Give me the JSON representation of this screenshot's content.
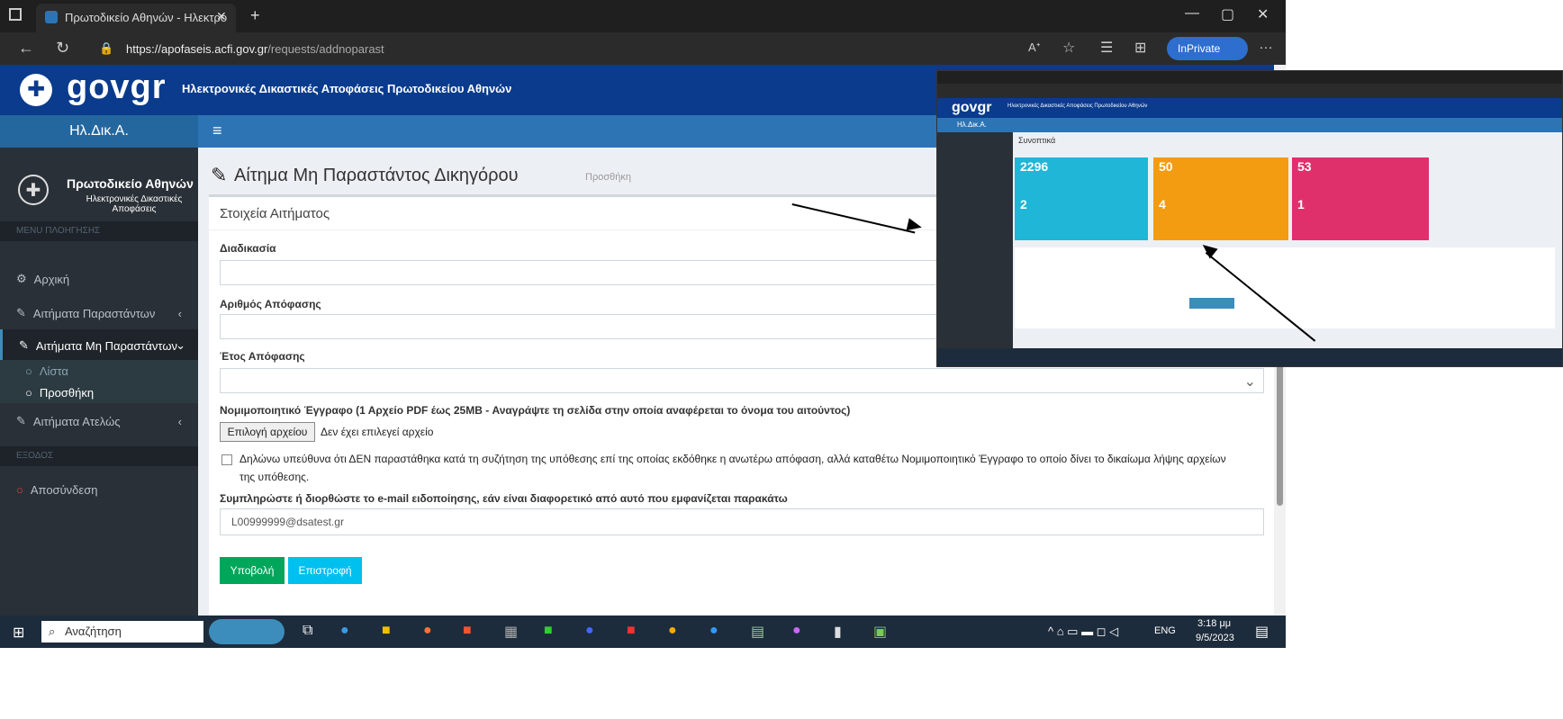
{
  "browser": {
    "tab_title": "Πρωτοδικείο Αθηνών - Ηλεκτρο",
    "url_domain": "https://apofaseis.acfi.gov.gr",
    "url_path": "/requests/addnoparast",
    "inprivate": "InPrivate"
  },
  "site": {
    "logo": "govgr",
    "header_title": "Ηλεκτρονικές Δικαστικές Αποφάσεις Πρωτοδικείου Αθηνών",
    "brand": "Ηλ.Δικ.Α.",
    "menu_icon": "hamburger-icon"
  },
  "sidebar": {
    "org_title": "Πρωτοδικείο Αθηνών",
    "org_subtitle_1": "Ηλεκτρονικές Δικαστικές",
    "org_subtitle_2": "Αποφάσεις",
    "section_main": "MENU ΠΛΟΗΓΗΣΗΣ",
    "items": [
      {
        "label": "Αρχική",
        "icon": "dashboard-icon"
      },
      {
        "label": "Αιτήματα Παραστάντων",
        "icon": "edit-icon"
      },
      {
        "label": "Αιτήματα Μη Παραστάντων",
        "icon": "edit-icon"
      },
      {
        "label": "Λίστα",
        "icon": "circle-icon"
      },
      {
        "label": "Προσθήκη",
        "icon": "circle-icon"
      },
      {
        "label": "Αιτήματα Ατελώς",
        "icon": "edit-icon"
      }
    ],
    "section_exit": "ΕΞΟΔΟΣ",
    "logout": "Αποσύνδεση"
  },
  "page": {
    "title": "Αίτημα Μη Παραστάντος Δικηγόρου",
    "subtitle": "Προσθήκη",
    "box_title": "Στοιχεία Αιτήματος",
    "label_procedure": "Διαδικασία",
    "label_decision_number": "Αριθμός Απόφασης",
    "label_decision_year": "Έτος Απόφασης",
    "label_document": "Νομιμοποιητικό Έγγραφο (1 Αρχείο PDF έως 25MB - Αναγράψτε τη σελίδα στην οποία αναφέρεται το όνομα του αιτούντος)",
    "file_button": "Επιλογή αρχείου",
    "file_status": "Δεν έχει επιλεγεί αρχείο",
    "declaration_1": "Δηλώνω υπεύθυνα ότι ΔΕΝ παραστάθηκα κατά τη συζήτηση της υπόθεσης επί της οποίας εκδόθηκε η ανωτέρω απόφαση, αλλά καταθέτω Νομιμοποιητικό Έγγραφο το οποίο δίνει το δικαίωμα λήψης αρχείων",
    "declaration_2": "της υπόθεσης.",
    "label_email": "Συμπληρώστε ή διορθώστε το e-mail ειδοποίησης, εάν είναι διαφορετικό από αυτό που εμφανίζεται παρακάτω",
    "email_value": "L00999999@dsatest.gr",
    "submit": "Υποβολή",
    "back": "Επιστροφή"
  },
  "taskbar": {
    "search": "Αναζήτηση",
    "lang": "ENG",
    "time": "3:18 μμ",
    "date": "9/5/2023"
  },
  "inset": {
    "header": "Ηλεκτρονικές Δικαστικές Αποφάσεις Πρωτοδικείου Αθηνών",
    "brand": "Ηλ.Δικ.Α.",
    "section": "Συνοπτικά",
    "cards": [
      {
        "big": "2296",
        "small": "2",
        "color": "#1fb6d8"
      },
      {
        "big": "50",
        "small": "4",
        "color": "#f39c12"
      },
      {
        "big": "53",
        "small": "1",
        "color": "#e0306b"
      }
    ]
  }
}
